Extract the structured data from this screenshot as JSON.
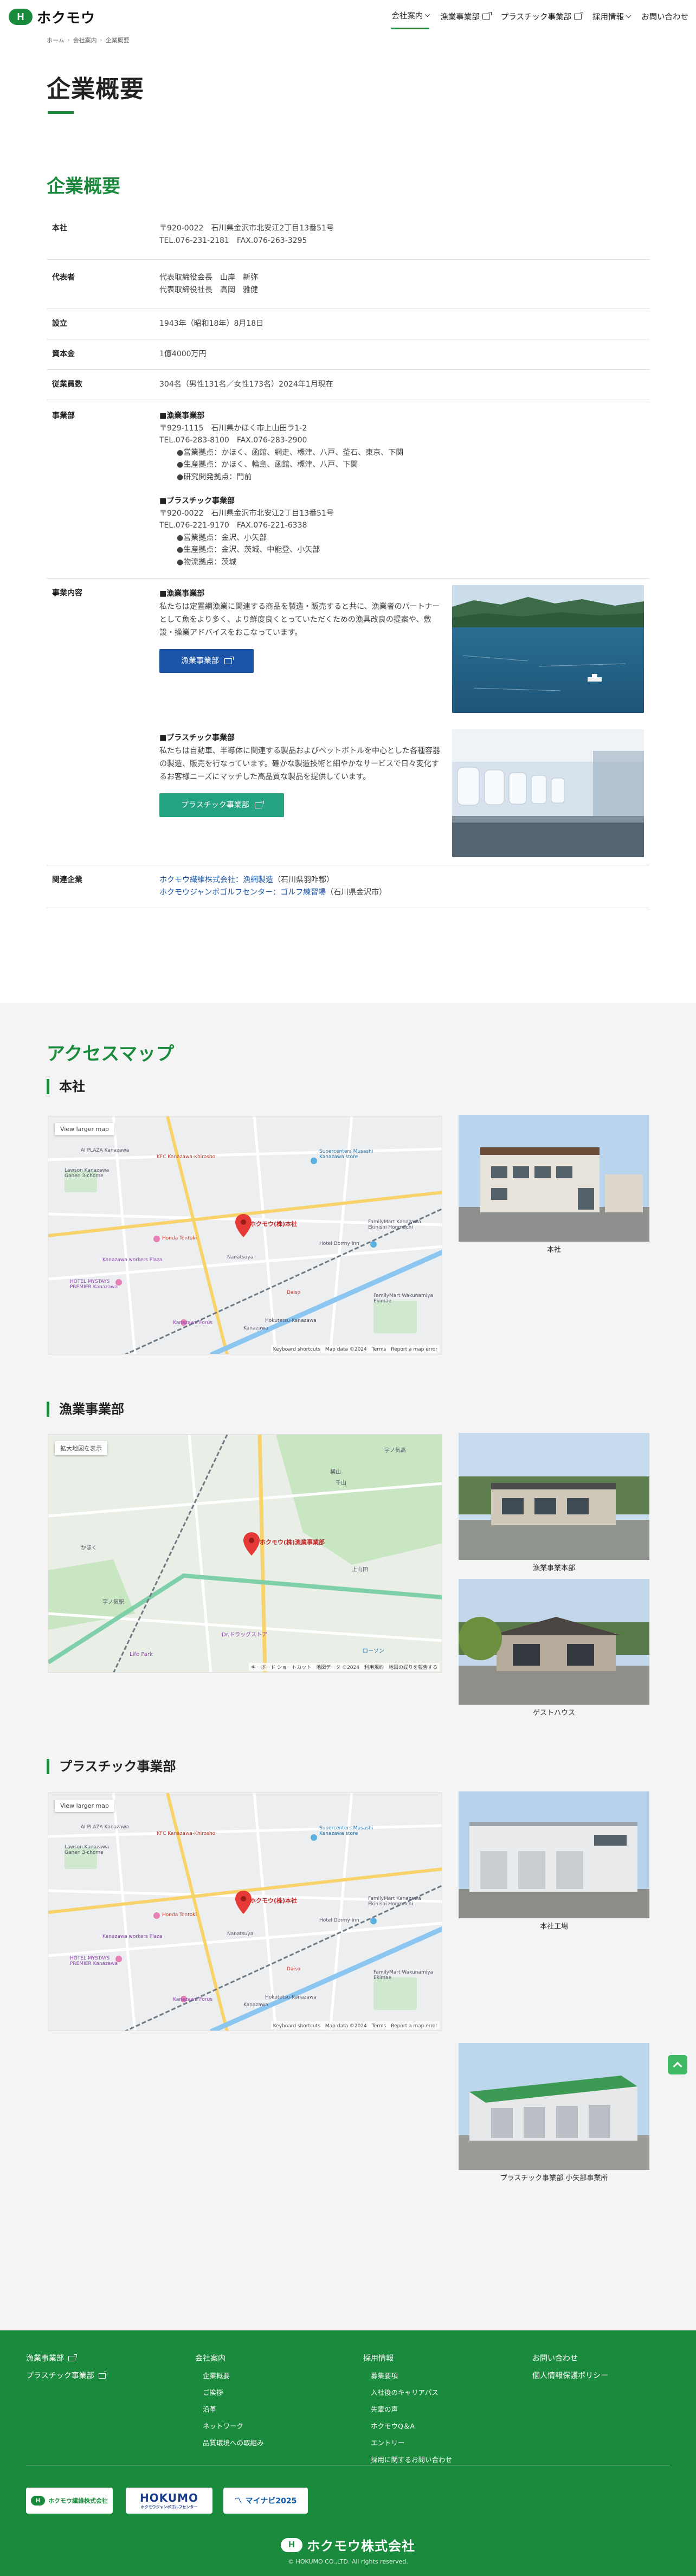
{
  "header": {
    "logo_mark": "H",
    "logo_text": "ホクモウ",
    "nav": [
      {
        "label": "会社案内",
        "type": "dropdown",
        "active": true
      },
      {
        "label": "漁業事業部",
        "type": "external"
      },
      {
        "label": "プラスチック事業部",
        "type": "external"
      },
      {
        "label": "採用情報",
        "type": "dropdown"
      },
      {
        "label": "お問い合わせ",
        "type": "link"
      }
    ]
  },
  "breadcrumb": [
    "ホーム",
    "会社案内",
    "企業概要"
  ],
  "page_title": "企業概要",
  "company": {
    "heading": "企業概要",
    "rows": {
      "hq": {
        "label": "本社",
        "lines": [
          "〒920-0022　石川県金沢市北安江2丁目13番51号",
          "TEL.076-231-2181　FAX.076-263-3295"
        ]
      },
      "rep": {
        "label": "代表者",
        "lines": [
          "代表取締役会長　山岸　新弥",
          "代表取締役社長　高岡　雅健"
        ]
      },
      "est": {
        "label": "設立",
        "value": "1943年（昭和18年）8月18日"
      },
      "cap": {
        "label": "資本金",
        "value": "1億4000万円"
      },
      "emp": {
        "label": "従業員数",
        "value": "304名（男性131名／女性173名）2024年1月現在"
      },
      "div": {
        "label": "事業部",
        "fish": {
          "title": "■漁業事業部",
          "addr": "〒929-1115　石川県かほく市上山田ラ1-2",
          "tel": "TEL.076-283-8100　FAX.076-283-2900",
          "items": [
            "●営業拠点：かほく、函館、網走、標津、八戸、釜石、東京、下関",
            "●生産拠点：かほく、輪島、函館、標津、八戸、下関",
            "●研究開発拠点：門前"
          ]
        },
        "plastic": {
          "title": "■プラスチック事業部",
          "addr": "〒920-0022　石川県金沢市北安江2丁目13番51号",
          "tel": "TEL.076-221-9170　FAX.076-221-6338",
          "items": [
            "●営業拠点：金沢、小矢部",
            "●生産拠点：金沢、茨城、中能登、小矢部",
            "●物流拠点：茨城"
          ]
        }
      },
      "biz": {
        "label": "事業内容",
        "fish": {
          "title": "■漁業事業部",
          "text": "私たちは定置網漁業に関連する商品を製造・販売すると共に、漁業者のパートナーとして魚をより多く、より鮮度良くとっていただくための漁具改良の提案や、敷設・操業アドバイスをおこなっています。",
          "button": "漁業事業部"
        },
        "plastic": {
          "title": "■プラスチック事業部",
          "text": "私たちは自動車、半導体に関連する製品およびペットボトルを中心とした各種容器の製造、販売を行なっています。確かな製造技術と細やかなサービスで日々変化するお客様ニーズにマッチした高品質な製品を提供しています。",
          "button": "プラスチック事業部"
        }
      },
      "rel": {
        "label": "関連企業",
        "items": [
          {
            "name": "ホクモウ繊維株式会社：漁網製造",
            "loc": "（石川県羽咋郡）"
          },
          {
            "name": "ホクモウジャンボゴルフセンター：ゴルフ練習場",
            "loc": "（石川県金沢市）"
          }
        ]
      }
    }
  },
  "access": {
    "heading": "アクセスマップ",
    "hq": {
      "title": "本社",
      "photo_caption": "本社",
      "map": {
        "btn": "View larger map",
        "pin": "ホクモウ(株)本社",
        "foot": "Keyboard shortcuts　Map data ©2024　Terms　Report a map error",
        "labels": [
          "AI PLAZA Kanazawa",
          "Lawson Kanazawa Ganen 3-chome",
          "KFC Kanazawa-Khirosho",
          "Supercenters Musashi Kanazawa store",
          "FamilyMart Kanazawa Ekinishi Honmachi",
          "Honda Tontoki",
          "Kanazawa workers Plaza",
          "HOTEL MYSTAYS PREMIER Kanazawa",
          "Nanatsuya",
          "Kanazawa Forus",
          "Daiso",
          "Hokutetsu-Kanazawa",
          "Kanazawa",
          "FamilyMart Wakunamiya Ekimae",
          "Hotel Dormy Inn"
        ]
      }
    },
    "fish": {
      "title": "漁業事業部",
      "photo_caption1": "漁業事業本部",
      "photo_caption2": "ゲストハウス",
      "map": {
        "btn": "拡大地図を表示",
        "pin": "ホクモウ(株)漁業事業部",
        "foot": "キーボード ショートカット　地図データ ©2024　利用規約　地図の誤りを報告する",
        "labels": [
          "宇ノ気高",
          "横山",
          "千山",
          "上山田",
          "宇ノ気駅",
          "Dr.ドラッグストア",
          "Life Park",
          "ローソン",
          "かほく"
        ]
      }
    },
    "plastic": {
      "title": "プラスチック事業部",
      "photo_caption1": "本社工場",
      "photo_caption2": "プラスチック事業部 小矢部事業所",
      "map": {
        "btn": "View larger map",
        "pin": "ホクモウ(株)本社",
        "foot": "Keyboard shortcuts　Map data ©2024　Terms　Report a map error",
        "labels": [
          "AI PLAZA Kanazawa",
          "Lawson Kanazawa Ganen 3-chome",
          "KFC Kanazawa-Khirosho",
          "Supercenters Musashi Kanazawa store",
          "FamilyMart Kanazawa Ekinishi Honmachi",
          "Honda Tontoki",
          "Kanazawa workers Plaza",
          "HOTEL MYSTAYS PREMIER Kanazawa",
          "Nanatsuya",
          "Kanazawa Forus",
          "Daiso",
          "Hokutetsu-Kanazawa",
          "Kanazawa",
          "FamilyMart Wakunamiya Ekimae",
          "Hotel Dormy Inn"
        ]
      }
    }
  },
  "footer": {
    "col1": [
      "漁業事業部",
      "プラスチック事業部"
    ],
    "col2": {
      "head": "会社案内",
      "items": [
        "企業概要",
        "ご挨拶",
        "沿革",
        "ネットワーク",
        "品質環境への取組み"
      ]
    },
    "col3": {
      "head": "採用情報",
      "items": [
        "募集要項",
        "入社後のキャリアパス",
        "先輩の声",
        "ホクモウQ＆A",
        "エントリー",
        "採用に関するお問い合わせ"
      ]
    },
    "col4": [
      "お問い合わせ",
      "個人情報保護ポリシー"
    ],
    "banners": [
      {
        "text": "ホクモウ繊維株式会社"
      },
      {
        "text": "HOKUMO",
        "sub": "ホクモウジャンボゴルフセンター"
      },
      {
        "text": "マイナビ2025"
      }
    ],
    "logo_text": "ホクモウ株式会社",
    "copyright": "© HOKUMO CO.,LTD. All rights reserved."
  },
  "colors": {
    "brand_green": "#1a8a3c",
    "button_blue": "#1c55a8",
    "button_teal": "#23a380"
  }
}
